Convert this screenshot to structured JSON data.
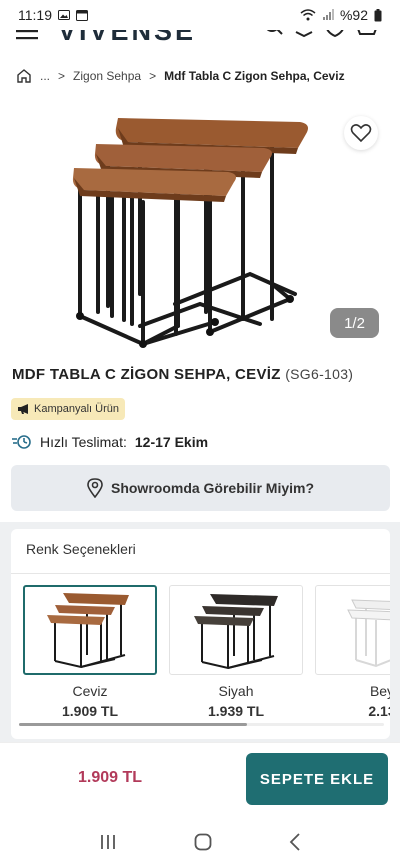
{
  "status_bar": {
    "time": "11:19",
    "battery": "%92"
  },
  "header": {
    "logo": "VIVENSE"
  },
  "breadcrumb": {
    "ellipsis": "...",
    "sep1": ">",
    "category": "Zigon Sehpa",
    "sep2": ">",
    "current": "Mdf Tabla C Zigon Sehpa, Ceviz"
  },
  "gallery": {
    "counter": "1/2"
  },
  "product": {
    "title": "MDF TABLA C ZİGON SEHPA, CEVİZ",
    "code": "(SG6-103)",
    "campaign_badge": "Kampanyalı Ürün",
    "delivery_label": "Hızlı Teslimat:",
    "delivery_value": "12-17 Ekim",
    "showroom_button": "Showroomda Görebilir Miyim?"
  },
  "colors": {
    "title": "Renk Seçenekleri",
    "options": [
      {
        "name": "Ceviz",
        "price": "1.909 TL",
        "selected": true,
        "color": "#9a5a30"
      },
      {
        "name": "Siyah",
        "price": "1.939 TL",
        "selected": false,
        "color": "#2e2a28"
      },
      {
        "name": "Bey",
        "price": "2.13",
        "selected": false,
        "color": "#f2f2f2"
      }
    ]
  },
  "buy_bar": {
    "price": "1.909 TL",
    "cart_button": "SEPETE EKLE"
  },
  "theme": {
    "accent": "#1f6e72",
    "price_color": "#b23a5a",
    "wood": "#9a5a30"
  }
}
